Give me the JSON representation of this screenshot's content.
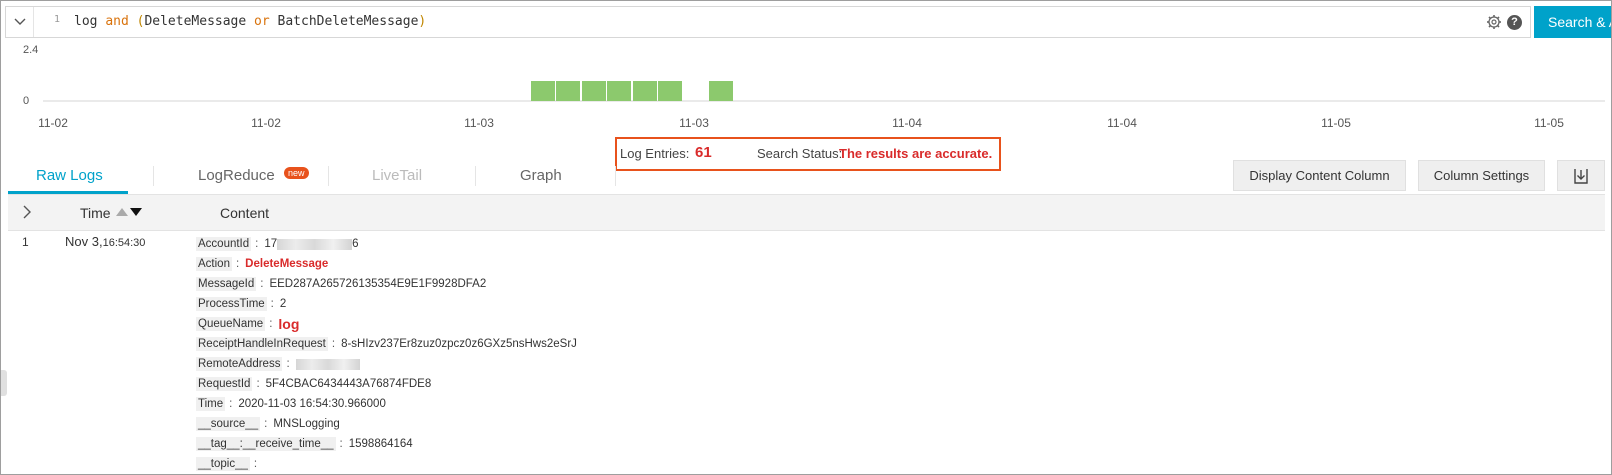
{
  "query": {
    "line_number": "1",
    "tokens": {
      "t1": "log",
      "t2": "and",
      "t3": "(",
      "t4": "DeleteMessage",
      "t5": "or",
      "t6": "BatchDeleteMessage",
      "t7": ")"
    },
    "help_glyph": "?",
    "search_label": "Search & A"
  },
  "histogram": {
    "y_ticks": [
      "2.4",
      "0"
    ],
    "x_ticks": [
      "11-02",
      "11-02",
      "11-03",
      "11-03",
      "11-04",
      "11-04",
      "11-05",
      "11-05"
    ],
    "bar_color": "#8cc96d"
  },
  "summary": {
    "log_entries_label": "Log Entries:",
    "log_entries_count": "61",
    "search_status_label": "Search Status:",
    "search_status_value": "The results are accurate."
  },
  "tabs": [
    {
      "label": "Raw Logs",
      "state": "active"
    },
    {
      "label": "LogReduce",
      "state": "normal",
      "badge": "new"
    },
    {
      "label": "LiveTail",
      "state": "disabled"
    },
    {
      "label": "Graph",
      "state": "normal"
    }
  ],
  "toolbar": {
    "display_content_column": "Display Content Column",
    "column_settings": "Column Settings"
  },
  "table": {
    "columns": [
      "Time",
      "Content"
    ],
    "row": {
      "index": "1",
      "date": "Nov 3,",
      "time": "16:54:30",
      "fields": [
        {
          "key": "AccountId",
          "value": "17",
          "value_suffix": "6"
        },
        {
          "key": "Action",
          "value": "DeleteMessage",
          "style": "red"
        },
        {
          "key": "MessageId",
          "value": "EED287A265726135354E9E1F9928DFA2"
        },
        {
          "key": "ProcessTime",
          "value": "2"
        },
        {
          "key": "QueueName",
          "value": "log",
          "style": "red-big"
        },
        {
          "key": "ReceiptHandleInRequest",
          "value": "8-sHIzv237Er8zuz0zpcz0z6GXz5nsHws2eSrJ"
        },
        {
          "key": "RemoteAddress",
          "value": ""
        },
        {
          "key": "RequestId",
          "value": "5F4CBAC6434443A76874FDE8"
        },
        {
          "key": "Time",
          "value": "2020-11-03 16:54:30.966000"
        },
        {
          "key": "__source__",
          "value": "MNSLogging"
        },
        {
          "key": "__tag__:__receive_time__",
          "value": "1598864164"
        },
        {
          "key": "__topic__",
          "value": ""
        }
      ]
    }
  },
  "colors": {
    "accent": "#00a2ca",
    "highlight": "#e8521c",
    "error_red": "#d92b2b"
  }
}
